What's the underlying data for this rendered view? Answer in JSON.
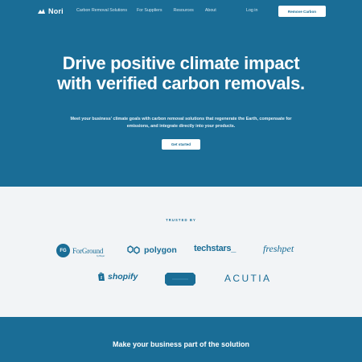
{
  "nav": {
    "logo_text": "Nori",
    "links": [
      "Carbon Removal Solutions",
      "For Suppliers",
      "Resources",
      "About"
    ],
    "login_label": "Log in",
    "cta_label": "Remove Carbon"
  },
  "hero": {
    "title": "Drive positive climate impact with verified carbon removals.",
    "subtitle": "Meet your business' climate goals with carbon removal solutions that regenerate the Earth, compensate for emissions, and integrate directly into your products.",
    "cta_label": "Get started"
  },
  "trusted": {
    "label": "TRUSTED BY",
    "brands": {
      "forground_badge": "FG",
      "forground": "ForGround",
      "forground_tag": "by Bayer",
      "polygon": "polygon",
      "techstars": "techstars_",
      "freshpet": "freshpet",
      "shopify": "shopify",
      "acutia": "ACUTIA"
    }
  },
  "cta_band": {
    "title": "Make your business part of the solution"
  },
  "colors": {
    "brand_blue": "#1a6d96",
    "light_bg": "#f2f4f6",
    "white": "#ffffff"
  },
  "icons": [
    "nori-logo-icon",
    "polygon-logo-icon",
    "shopify-bag-icon",
    "box-logo-icon"
  ]
}
